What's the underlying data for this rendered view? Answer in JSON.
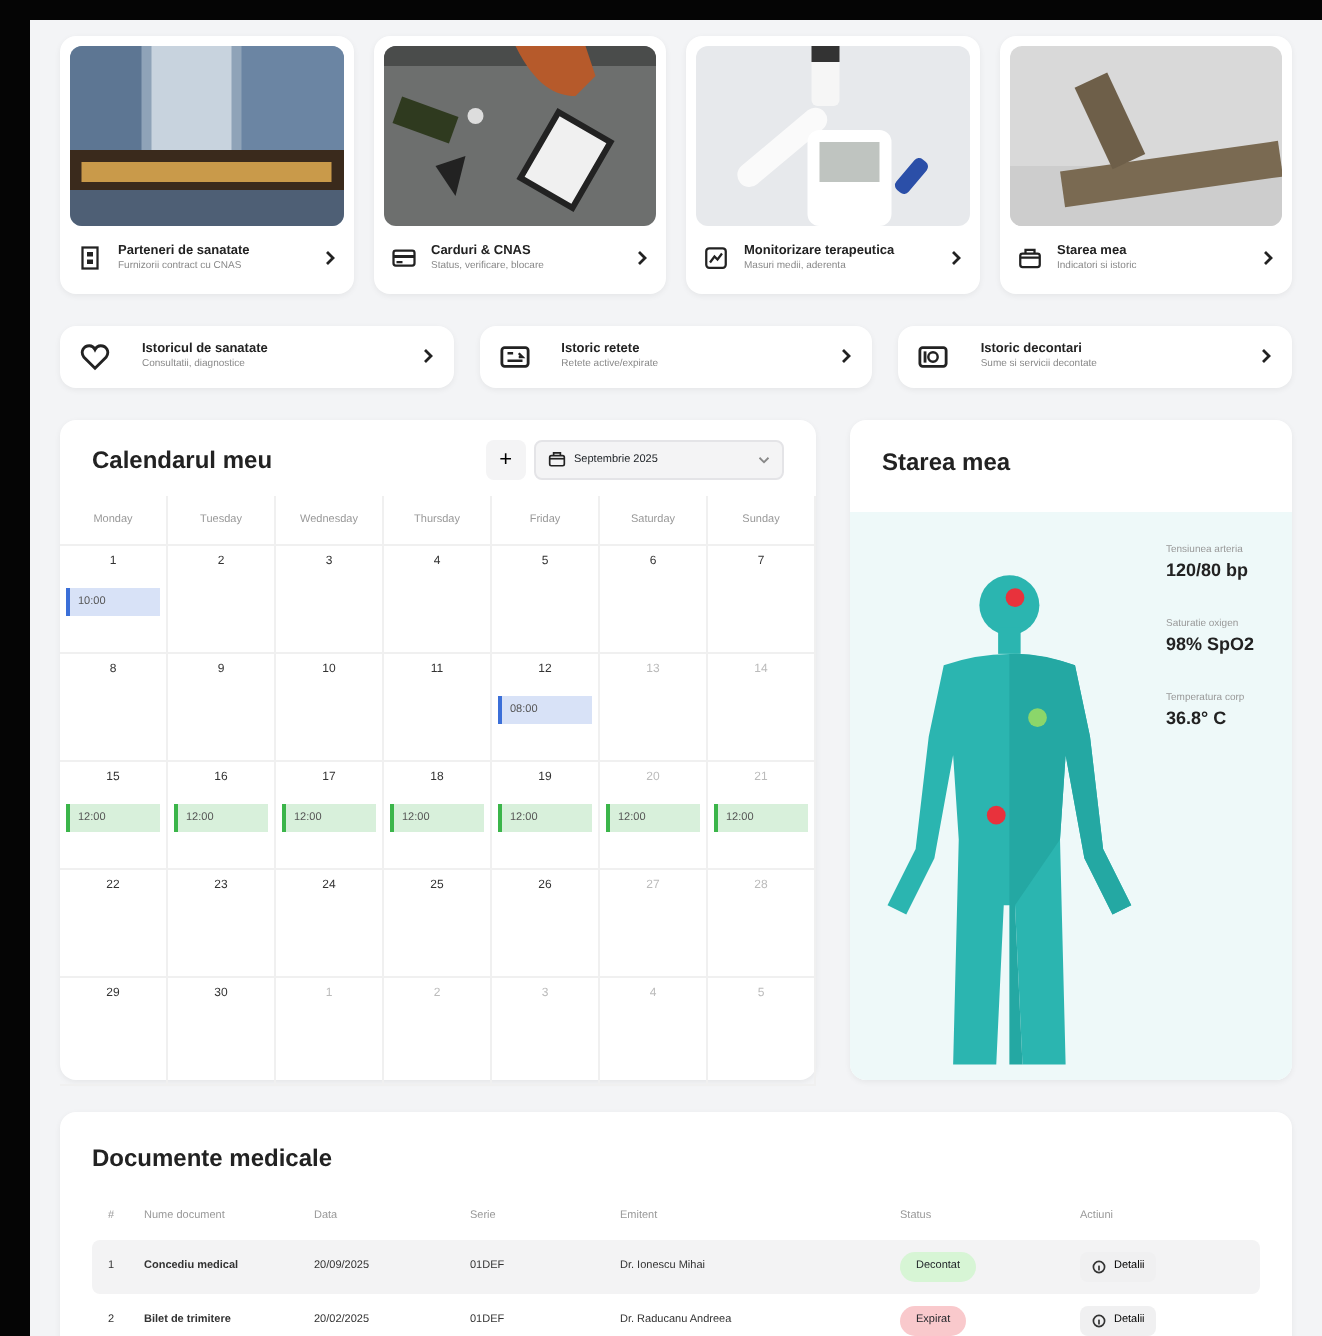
{
  "service_cards": [
    {
      "title": "Parteneri de sanatate",
      "subtitle": "Furnizorii contract cu CNAS"
    },
    {
      "title": "Carduri & CNAS",
      "subtitle": "Status, verificare, blocare"
    },
    {
      "title": "Monitorizare terapeutica",
      "subtitle": "Masuri medii, aderenta"
    },
    {
      "title": "Starea mea",
      "subtitle": "Indicatori si istoric"
    }
  ],
  "history_cards": [
    {
      "title": "Istoricul de sanatate",
      "subtitle": "Consultatii, diagnostice"
    },
    {
      "title": "Istoric retete",
      "subtitle": "Retete active/expirate"
    },
    {
      "title": "Istoric decontari",
      "subtitle": "Sume si servicii decontate"
    }
  ],
  "calendar": {
    "title": "Calendarul meu",
    "add_label": "+",
    "month": "Septembrie 2025",
    "weekdays": [
      "Monday",
      "Tuesday",
      "Wednesday",
      "Thursday",
      "Friday",
      "Saturday",
      "Sunday"
    ],
    "weeks": [
      [
        {
          "day": "1",
          "muted": false,
          "events": [
            {
              "time": "10:00",
              "color": "#3b6fd8"
            }
          ]
        },
        {
          "day": "2",
          "muted": false
        },
        {
          "day": "3",
          "muted": false
        },
        {
          "day": "4",
          "muted": false
        },
        {
          "day": "5",
          "muted": false
        },
        {
          "day": "6",
          "muted": false
        },
        {
          "day": "7",
          "muted": false
        }
      ],
      [
        {
          "day": "8",
          "muted": false
        },
        {
          "day": "9",
          "muted": false
        },
        {
          "day": "10",
          "muted": false
        },
        {
          "day": "11",
          "muted": false
        },
        {
          "day": "12",
          "muted": false,
          "events": [
            {
              "time": "08:00",
              "color": "#3b6fd8"
            }
          ]
        },
        {
          "day": "13",
          "muted": true
        },
        {
          "day": "14",
          "muted": true
        }
      ],
      [
        {
          "day": "15",
          "muted": false,
          "events": [
            {
              "time": "12:00",
              "color": "#3bb54a"
            }
          ]
        },
        {
          "day": "16",
          "muted": false,
          "events": [
            {
              "time": "12:00",
              "color": "#3bb54a"
            }
          ]
        },
        {
          "day": "17",
          "muted": false,
          "events": [
            {
              "time": "12:00",
              "color": "#3bb54a"
            }
          ]
        },
        {
          "day": "18",
          "muted": false,
          "events": [
            {
              "time": "12:00",
              "color": "#3bb54a"
            }
          ]
        },
        {
          "day": "19",
          "muted": false,
          "events": [
            {
              "time": "12:00",
              "color": "#3bb54a"
            }
          ]
        },
        {
          "day": "20",
          "muted": true,
          "events": [
            {
              "time": "12:00",
              "color": "#3bb54a"
            }
          ]
        },
        {
          "day": "21",
          "muted": true,
          "events": [
            {
              "time": "12:00",
              "color": "#3bb54a"
            }
          ]
        }
      ],
      [
        {
          "day": "22",
          "muted": false
        },
        {
          "day": "23",
          "muted": false
        },
        {
          "day": "24",
          "muted": false
        },
        {
          "day": "25",
          "muted": false
        },
        {
          "day": "26",
          "muted": false
        },
        {
          "day": "27",
          "muted": true
        },
        {
          "day": "28",
          "muted": true
        }
      ],
      [
        {
          "day": "29",
          "muted": false
        },
        {
          "day": "30",
          "muted": false
        },
        {
          "day": "1",
          "muted": true
        },
        {
          "day": "2",
          "muted": true
        },
        {
          "day": "3",
          "muted": true
        },
        {
          "day": "4",
          "muted": true
        },
        {
          "day": "5",
          "muted": true
        }
      ]
    ]
  },
  "status": {
    "title": "Starea mea",
    "markers": [
      {
        "color": "#e8323c"
      },
      {
        "color": "#8bd66a"
      },
      {
        "color": "#e8323c"
      }
    ],
    "vitals": [
      {
        "label": "Tensiunea arteria",
        "value": "120/80 bp"
      },
      {
        "label": "Saturatie oxigen",
        "value": "98% SpO2"
      },
      {
        "label": "Temperatura corp",
        "value": "36.8° C"
      }
    ]
  },
  "documents": {
    "title": "Documente medicale",
    "columns": [
      "#",
      "Nume document",
      "Data",
      "Serie",
      "Emitent",
      "Status",
      "Actiuni"
    ],
    "rows": [
      {
        "index": "1",
        "name": "Concediu medical",
        "date": "20/09/2025",
        "series": "01DEF",
        "issuer": "Dr. Ionescu Mihai",
        "status": "Decontat",
        "color": "#d7f5d5",
        "selected": true,
        "action": "Detalii"
      },
      {
        "index": "2",
        "name": "Bilet de trimitere",
        "date": "20/02/2025",
        "series": "01DEF",
        "issuer": "Dr. Raducanu Andreea",
        "status": "Expirat",
        "color": "#f9c9cc",
        "selected": false,
        "action": "Detalii"
      }
    ]
  }
}
